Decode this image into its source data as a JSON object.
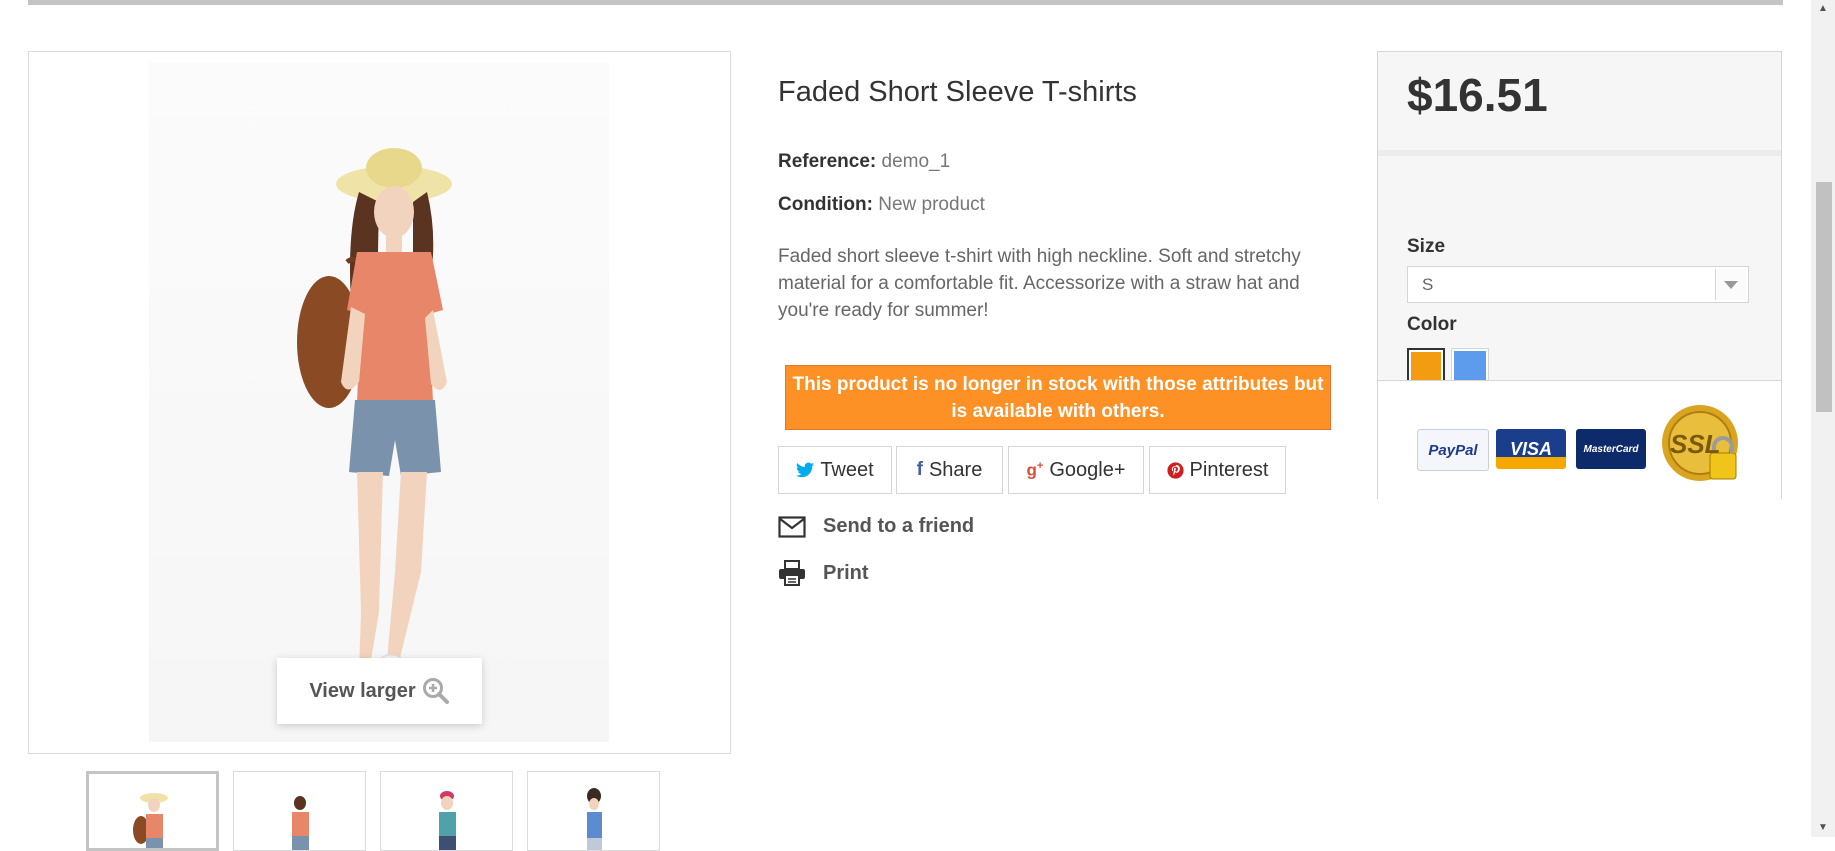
{
  "product": {
    "title": "Faded Short Sleeve T-shirts",
    "reference_label": "Reference:",
    "reference_value": "demo_1",
    "condition_label": "Condition:",
    "condition_value": "New product",
    "description": "Faded short sleeve t-shirt with high neckline. Soft and stretchy material for a comfortable fit. Accessorize with a straw hat and you're ready for summer!",
    "stock_alert": "This product is no longer in stock with those attributes but is available with others."
  },
  "image": {
    "view_larger_label": "View larger",
    "thumbnail_count": 4
  },
  "social": {
    "tweet": "Tweet",
    "share": "Share",
    "google": "Google+",
    "pinterest": "Pinterest"
  },
  "actions": {
    "send_friend": "Send to a friend",
    "print": "Print"
  },
  "buy_box": {
    "price": "$16.51",
    "size_label": "Size",
    "size_selected": "S",
    "color_label": "Color",
    "colors": [
      "#f39c11",
      "#5d9cec"
    ],
    "payment_logos": [
      "PayPal",
      "VISA",
      "MasterCard",
      "SSL"
    ]
  },
  "colors": {
    "alert_bg": "#fe9126",
    "twitter": "#00aaf0",
    "facebook": "#435f9f",
    "google": "#e04b34",
    "pinterest": "#ce1f21"
  }
}
